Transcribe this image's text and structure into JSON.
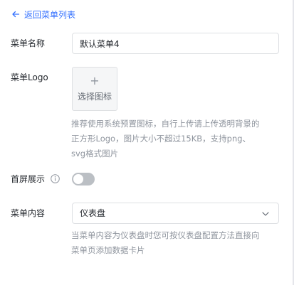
{
  "back": {
    "label": "返回菜单列表"
  },
  "form": {
    "name": {
      "label": "菜单名称",
      "value": "默认菜单4"
    },
    "logo": {
      "label": "菜单Logo",
      "picker_label": "选择图标",
      "plus_glyph": "+",
      "hint_lines": [
        "推荐使用系统预置图标，自行上传请上传透明背景的",
        "正方形Logo，图片大小不超过15KB，支持png、",
        "svg格式图片"
      ]
    },
    "first_screen": {
      "label": "首屏展示",
      "enabled": false
    },
    "content": {
      "label": "菜单内容",
      "selected": "仪表盘",
      "hint_lines": [
        "当菜单内容为仪表盘时您可按仪表盘配置方法直接向",
        "菜单页添加数据卡片"
      ]
    }
  },
  "colors": {
    "accent": "#3370ff",
    "toggle_off": "#bbbfc4",
    "hint_text": "#8f959e"
  },
  "icons": [
    "arrow-left-icon",
    "plus-icon",
    "info-icon",
    "chevron-down-icon"
  ]
}
